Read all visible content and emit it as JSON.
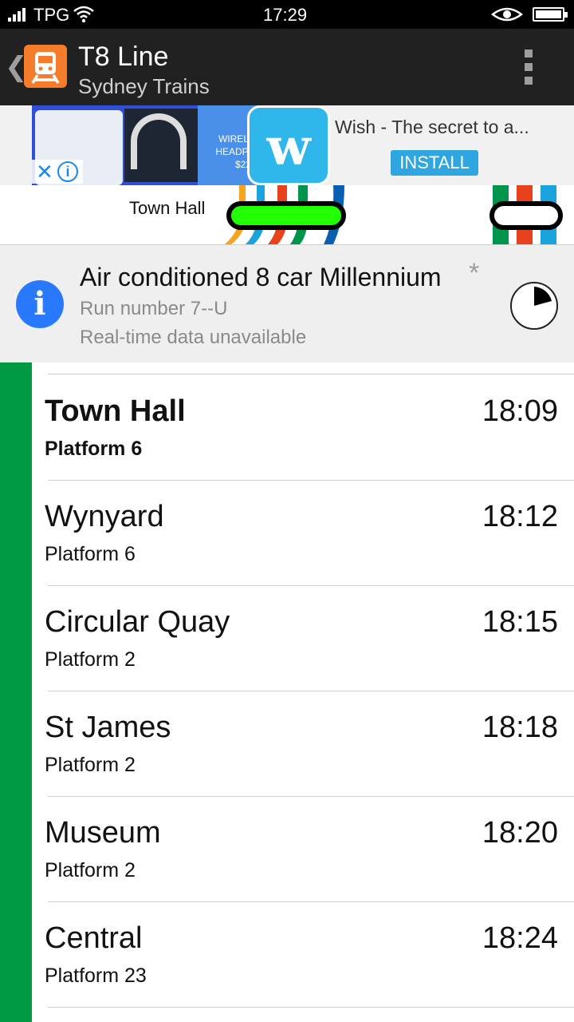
{
  "status_bar": {
    "carrier": "TPG",
    "time": "17:29",
    "icons": [
      "signal-icon",
      "wifi-icon",
      "eye-icon",
      "battery-icon"
    ]
  },
  "app_bar": {
    "title": "T8 Line",
    "subtitle": "Sydney Trains",
    "icons": [
      "back-chevron-icon",
      "train-icon",
      "overflow-menu-icon"
    ],
    "icon_color": "#f57c2b"
  },
  "ad": {
    "image_text": "WIRELESS HEADPHO... $22",
    "headline": "Wish - The secret to a...",
    "install_label": "INSTALL",
    "logo_letter": "w"
  },
  "track_map": {
    "station_label": "Town Hall",
    "active_color": "#22ff00"
  },
  "service": {
    "title": "Air conditioned 8 car Millennium",
    "asterisk": "*",
    "run_number": "Run number 7--U",
    "realtime_status": "Real-time data unavailable",
    "info_icon_glyph": "i"
  },
  "line_color": "#009a44",
  "stops": [
    {
      "name": "Town Hall",
      "platform": "Platform 6",
      "time": "18:09"
    },
    {
      "name": "Wynyard",
      "platform": "Platform 6",
      "time": "18:12"
    },
    {
      "name": "Circular Quay",
      "platform": "Platform 2",
      "time": "18:15"
    },
    {
      "name": "St James",
      "platform": "Platform 2",
      "time": "18:18"
    },
    {
      "name": "Museum",
      "platform": "Platform 2",
      "time": "18:20"
    },
    {
      "name": "Central",
      "platform": "Platform 23",
      "time": "18:24"
    }
  ]
}
